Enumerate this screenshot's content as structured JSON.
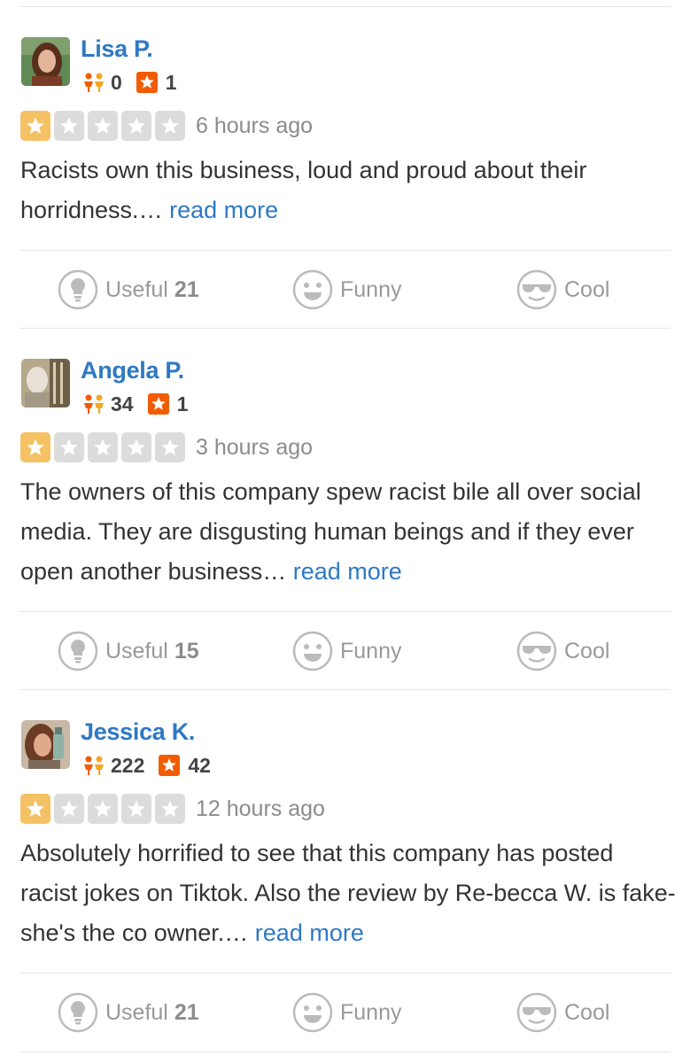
{
  "reviews": [
    {
      "user": {
        "name": "Lisa P.",
        "friends": "0",
        "review_count": "1"
      },
      "rating": 1,
      "date": "6 hours ago",
      "text": "Racists own this business, loud and proud about their horridness.… ",
      "read_more": "read more",
      "actions": {
        "useful_label": "Useful",
        "useful_count": "21",
        "funny_label": "Funny",
        "cool_label": "Cool"
      }
    },
    {
      "user": {
        "name": "Angela P.",
        "friends": "34",
        "review_count": "1"
      },
      "rating": 1,
      "date": "3 hours ago",
      "text": "The owners of this company spew racist bile all over social media. They are disgusting human beings and if they ever open another business… ",
      "read_more": "read more",
      "actions": {
        "useful_label": "Useful",
        "useful_count": "15",
        "funny_label": "Funny",
        "cool_label": "Cool"
      }
    },
    {
      "user": {
        "name": "Jessica K.",
        "friends": "222",
        "review_count": "42"
      },
      "rating": 1,
      "date": "12 hours ago",
      "text": "Absolutely horrified to see that this company has posted racist jokes on Tiktok. Also the review by Re-becca W. is fake- she's the co owner.… ",
      "read_more": "read more",
      "actions": {
        "useful_label": "Useful",
        "useful_count": "21",
        "funny_label": "Funny",
        "cool_label": "Cool"
      }
    }
  ],
  "colors": {
    "link": "#2e79c4",
    "star_filled": "#f4c164",
    "star_empty": "#dcdcdc",
    "review_badge": "#f15c00",
    "friends_icon": "#f15c00"
  },
  "icons": {
    "friends": "friends-icon",
    "review_count": "review-star-icon",
    "useful": "lightbulb-icon",
    "funny": "smiley-icon",
    "cool": "sunglasses-icon"
  }
}
